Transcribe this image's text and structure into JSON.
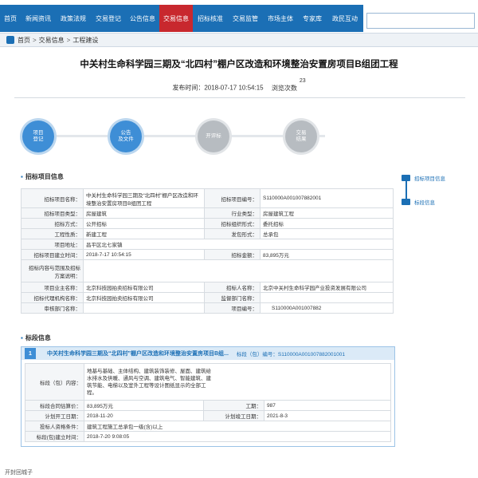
{
  "nav": {
    "items": [
      "首页",
      "新闻资讯",
      "政策法规",
      "交易登记",
      "公告信息",
      "交易信息",
      "招标核准",
      "交易监管",
      "市场主体",
      "专家库",
      "政民互动"
    ],
    "active_index": 5,
    "search_placeholder": ""
  },
  "breadcrumb": {
    "home": "首页",
    "level1": "交易信息",
    "level2": "工程建设"
  },
  "project": {
    "title": "中关村生命科学园三期及“北四村”棚户区改造和环境整治安置房项目B组团工程",
    "publish_label": "发布时间：2018-07-17 10:54:15",
    "views_label": "浏览次数",
    "views_count": "23"
  },
  "steps": [
    {
      "label1": "项目",
      "label2": "登记",
      "state": "on"
    },
    {
      "label1": "公告",
      "label2": "及文件",
      "state": "on"
    },
    {
      "label1": "开评标",
      "label2": "",
      "state": "off"
    },
    {
      "label1": "交易",
      "label2": "结果",
      "state": "off"
    }
  ],
  "sections": {
    "project_info": "招标项目信息",
    "bid_info": "标段信息"
  },
  "side_nav": {
    "item1": "招标项目信息",
    "item2": "标段信息"
  },
  "project_table": {
    "name_key": "招标项目名称：",
    "name_val": "中关村生命科学园三期及“北四村”棚户区改造和环境整治安置房项目B组团工程",
    "code_key": "招标项目编号：",
    "code_val": "S110000A001007882001",
    "type_key": "招标项目类型：",
    "type_val": "房屋建筑",
    "industry_key": "行业类型：",
    "industry_val": "房屋建筑工程",
    "method_key": "招标方式：",
    "method_val": "公开招标",
    "org_key": "招标组织形式：",
    "org_val": "委托招标",
    "nature_key": "工程性质：",
    "nature_val": "新建工程",
    "contract_key": "发包形式：",
    "contract_val": "总承包",
    "address_key": "项目地址：",
    "address_val": "昌平区北七家镇",
    "date_key": "招标项目建立时间：",
    "date_val": "2018-7-17 10:54:15",
    "amount_key": "招标金额：",
    "amount_val": "83,895万元",
    "scope_key": "招标内容与范围及招标方案说明：",
    "scope_val": "",
    "owner_key": "项目业主名称：",
    "owner_val": "北京科技园拍卖招标有限公司",
    "tenderer_key": "招标人名称：",
    "tenderer_val": "北京中关村生命科学园产业投资发展有限公司",
    "agent_key": "招标代理机构名称：",
    "agent_val": "北京科技园拍卖招标有限公司",
    "supervise_key": "监督部门名称：",
    "supervise_val": "",
    "review_key": "审核部门名称：",
    "review_val": "",
    "regno_key": "项目编号：",
    "regno_val": "S110000A001007882"
  },
  "bid": {
    "num": "1",
    "title": "中关村生命科学园三期及“北四村”棚户区改造和环境整治安置房项目B组...",
    "code_label": "标段（包）编号：S110000A001007882001001",
    "content_key": "标段（包）内容：",
    "content_val": "地基与基础、主体结构、建筑装饰装修、屋面、建筑给水排水及供暖、通风与空调、建筑电气、智能建筑、建筑节能、电梯以及室外工程等设计图纸显示的全部工程。",
    "price_key": "标段合同估算价：",
    "price_val": "83,895万元",
    "period_key": "工期：",
    "period_val": "987",
    "start_key": "计划开工日期：",
    "start_val": "2018-11-20",
    "end_key": "计划竣工日期：",
    "end_val": "2021-8-3",
    "qual_key": "投标人资格条件：",
    "qual_val": "建筑工程施工总承包一级(含)以上",
    "built_key": "标段(包)建立时间：",
    "built_val": "2018-7-20 9:08:05"
  },
  "footer_text": "开封回城子"
}
